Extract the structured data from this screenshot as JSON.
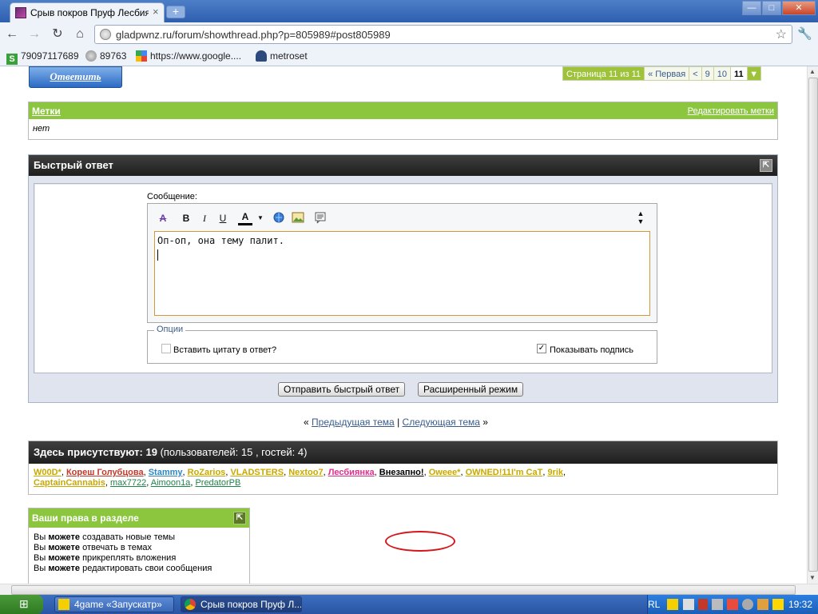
{
  "browser": {
    "tab_title": "Срыв покров Пруф Лесбиян",
    "tab_close": "×",
    "new_tab": "+",
    "url": "gladpwnz.ru/forum/showthread.php?p=805989#post805989",
    "window_min": "—",
    "window_max": "□",
    "window_close": "✕",
    "nav_back": "←",
    "nav_forward": "→",
    "nav_reload": "↻",
    "nav_home": "⌂",
    "star": "☆",
    "wrench": "🔧"
  },
  "bookmarks": [
    {
      "label": "79097117689",
      "icon": "s-icon"
    },
    {
      "label": "89763",
      "icon": "globe-icon"
    },
    {
      "label": "https://www.google....",
      "icon": "google-icon"
    },
    {
      "label": "metroset",
      "icon": "user-icon"
    }
  ],
  "forum": {
    "reply_button": "Ответить",
    "pagenav": {
      "info": "Страница 11 из 11",
      "first": "« Первая",
      "prev": "<",
      "p9": "9",
      "p10": "10",
      "current": "11",
      "dropdown": "▼"
    },
    "tags": {
      "title": "Метки",
      "edit": "Редактировать метки",
      "value": "нет"
    },
    "quick_reply": {
      "title": "Быстрый ответ",
      "message_label": "Сообщение:",
      "message_text": "Оп-оп, она тему палит.",
      "options_legend": "Опции",
      "option_quote": "Вставить цитату в ответ?",
      "option_signature": "Показывать подпись",
      "submit": "Отправить быстрый ответ",
      "advanced": "Расширенный режим",
      "toolbar": {
        "bold": "B",
        "italic": "I",
        "underline": "U",
        "color": "A"
      }
    },
    "thread_nav": {
      "left_marker": "«",
      "prev": "Предыдущая тема",
      "separator": "|",
      "next": "Следующая тема",
      "right_marker": "»"
    },
    "online": {
      "title_bold": "Здесь присутствуют: 19",
      "title_rest": "(пользователей: 15 , гостей: 4)",
      "users": [
        {
          "name": "W00D*",
          "color": "#c9a800",
          "bold": true
        },
        {
          "name": "Кореш Голубцова",
          "color": "#c0392b",
          "bold": true
        },
        {
          "name": "Stammy",
          "color": "#2e86c1",
          "bold": true
        },
        {
          "name": "RoZarios",
          "color": "#c9a800",
          "bold": true
        },
        {
          "name": "VLADSTERS",
          "color": "#c9a800",
          "bold": true
        },
        {
          "name": "Nextoo7",
          "color": "#c9a800",
          "bold": true
        },
        {
          "name": "Лесбиянка",
          "color": "#e0318a",
          "bold": true
        },
        {
          "name": "Внезапно!",
          "color": "#000000",
          "bold": true
        },
        {
          "name": "Oweee*",
          "color": "#c9a800",
          "bold": true
        },
        {
          "name": "OWNED!11I'm CaT",
          "color": "#c9a800",
          "bold": true
        },
        {
          "name": "9rik",
          "color": "#c9a800",
          "bold": true
        },
        {
          "name": "CaptainCannabis",
          "color": "#c9a800",
          "bold": true
        },
        {
          "name": "max7722",
          "color": "#1e8449",
          "bold": false
        },
        {
          "name": "Aimoon1a",
          "color": "#1e8449",
          "bold": false
        },
        {
          "name": "PredatorPB",
          "color": "#1e8449",
          "bold": false
        }
      ]
    },
    "permissions": {
      "title": "Ваши права в разделе",
      "rows": [
        {
          "pre": "Вы ",
          "bold": "можете",
          "post": " создавать новые темы"
        },
        {
          "pre": "Вы ",
          "bold": "можете",
          "post": " отвечать в темах"
        },
        {
          "pre": "Вы ",
          "bold": "можете",
          "post": " прикреплять вложения"
        },
        {
          "pre": "Вы ",
          "bold": "можете",
          "post": " редактировать свои сообщения"
        }
      ]
    }
  },
  "taskbar": {
    "tasks": [
      {
        "label": "4game «Запускатр»",
        "active": false
      },
      {
        "label": "Срыв покров Пруф Л...",
        "active": true
      }
    ],
    "lang": "RL",
    "clock": "19:32"
  }
}
